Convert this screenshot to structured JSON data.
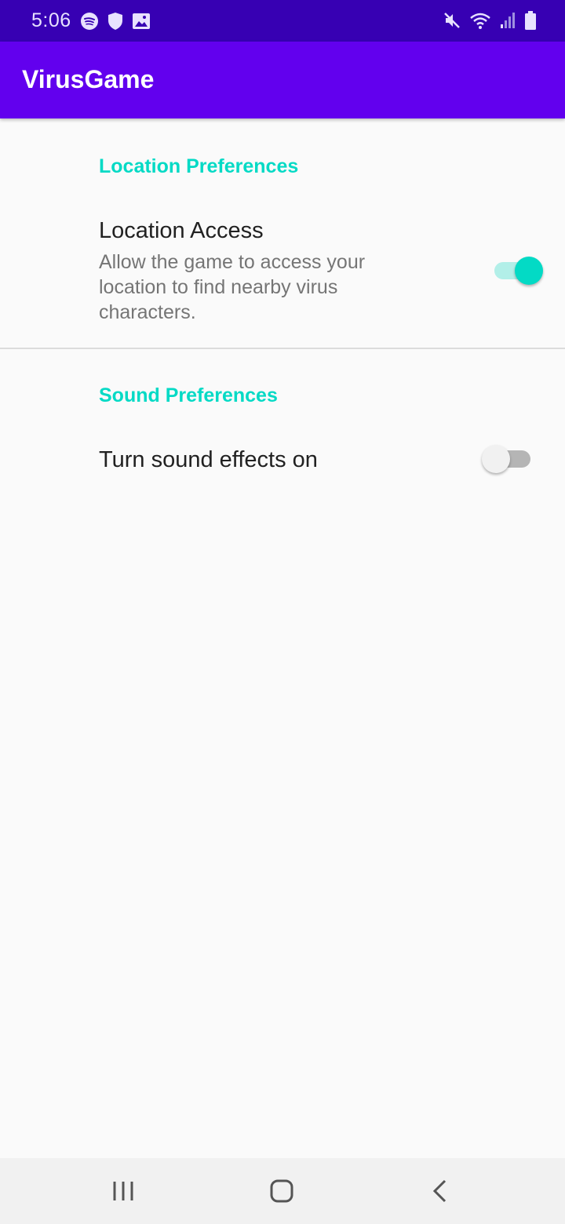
{
  "status_bar": {
    "time": "5:06",
    "left_icons": [
      "spotify-icon",
      "shield-icon",
      "image-icon"
    ],
    "right_icons": [
      "mute-icon",
      "wifi-icon",
      "signal-icon",
      "battery-icon"
    ],
    "background": "#3700b3"
  },
  "app_bar": {
    "title": "VirusGame",
    "background": "#6200ee"
  },
  "preferences": {
    "location": {
      "category": "Location Preferences",
      "title": "Location Access",
      "summary": "Allow the game to access your location to find nearby virus characters.",
      "enabled": true
    },
    "sound": {
      "category": "Sound Preferences",
      "title": "Turn sound effects on",
      "enabled": false
    }
  },
  "accent_color": "#03dac5",
  "nav_bar": {
    "buttons": [
      "recents-icon",
      "home-icon",
      "back-icon"
    ]
  }
}
